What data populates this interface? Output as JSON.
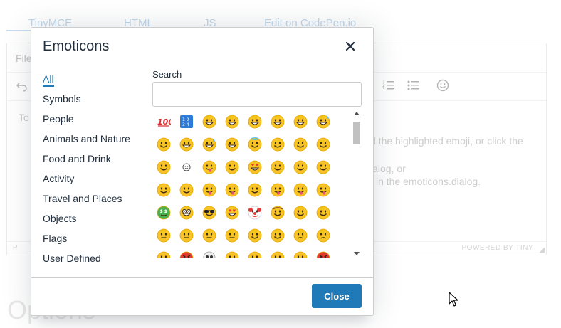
{
  "background": {
    "tabs": [
      "TinyMCE",
      "HTML",
      "JS",
      "Edit on CodePen.io"
    ],
    "menu_fragment": "File",
    "body_lines": {
      "line1_start": "To",
      "line1_end": "d the highlighted emoji, or click the",
      "line2_end": "ialog, or",
      "line3_end": "in the emoticons.dialog."
    },
    "status_path": "P",
    "powered_by": "POWERED BY TINY",
    "options_heading": "Options"
  },
  "dialog": {
    "title": "Emoticons",
    "categories": [
      {
        "label": "All",
        "active": true
      },
      {
        "label": "Symbols"
      },
      {
        "label": "People"
      },
      {
        "label": "Animals and Nature"
      },
      {
        "label": "Food and Drink"
      },
      {
        "label": "Activity"
      },
      {
        "label": "Travel and Places"
      },
      {
        "label": "Objects"
      },
      {
        "label": "Flags"
      },
      {
        "label": "User Defined"
      }
    ],
    "search_label": "Search",
    "search_value": "",
    "close_label": "Close",
    "accent_color": "#207ab7"
  }
}
